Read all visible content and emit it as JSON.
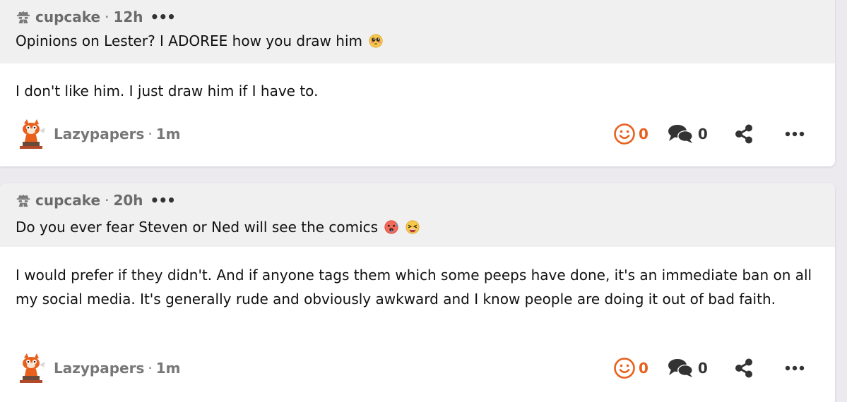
{
  "posts": [
    {
      "asker": "cupcake",
      "asker_time": "12h",
      "ask_more": "•••",
      "question": "Opinions on Lester? I ADOREE how you draw him",
      "question_emojis": [
        "pleading-face-emoji"
      ],
      "answer": "I don't like him. I just draw him if I have to.",
      "answerer": "Lazypapers",
      "answer_time": "1m",
      "reactions": "0",
      "comments": "0",
      "more": "•••"
    },
    {
      "asker": "cupcake",
      "asker_time": "20h",
      "ask_more": "•••",
      "question": "Do you ever fear Steven or Ned will see the comics",
      "question_emojis": [
        "hot-face-emoji",
        "weary-face-emoji"
      ],
      "answer": "I would prefer if they didn't. And if anyone tags them which some peeps have done, it's an immediate ban on all my social media. It's generally rude and obviously awkward and I know people are doing it out of bad faith.",
      "answerer": "Lazypapers",
      "answer_time": "1m",
      "reactions": "0",
      "comments": "0",
      "more": "•••"
    }
  ],
  "separator": "·",
  "colors": {
    "background": "#eceaef",
    "ask_background": "#f0f0f0",
    "accent_orange": "#e8601c",
    "muted_text": "#777777"
  }
}
